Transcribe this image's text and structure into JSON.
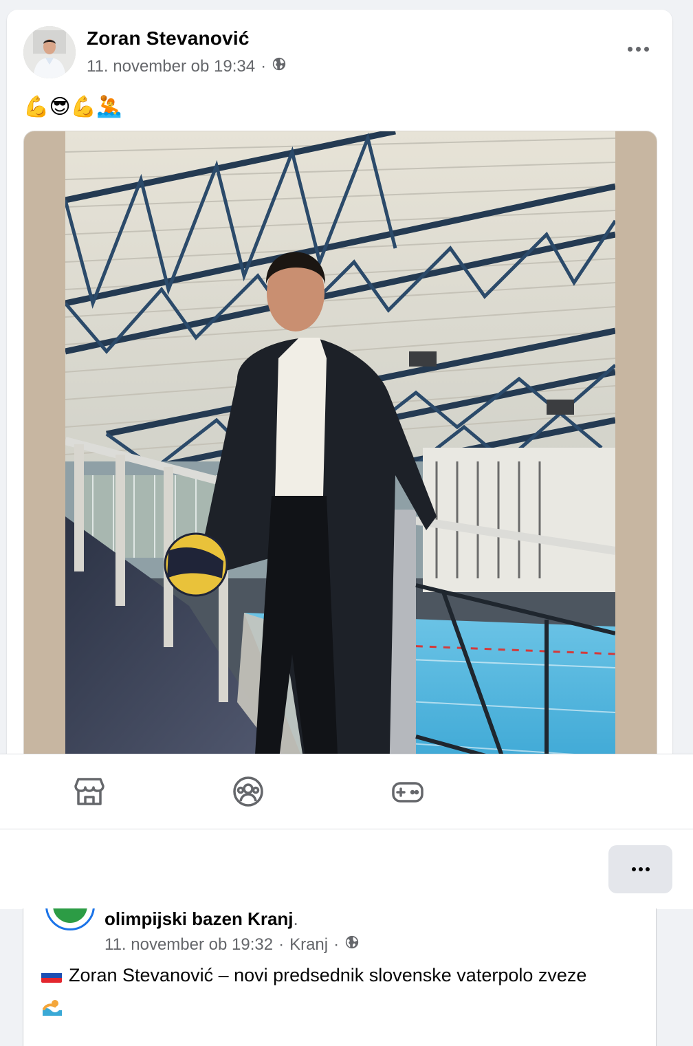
{
  "post": {
    "author": "Zoran Stevanović",
    "timestamp": "11. november ob 19:34",
    "separator": "·",
    "privacy_icon": "globe-icon",
    "more_icon": "more-horizontal-icon",
    "emojis": "💪😎💪🤽"
  },
  "bottom_nav": {
    "items": [
      {
        "icon": "marketplace-icon"
      },
      {
        "icon": "groups-icon"
      },
      {
        "icon": "gaming-icon"
      }
    ]
  },
  "toolbar": {
    "menu_icon": "more-horizontal-icon"
  },
  "shared_post": {
    "author": "olimpijski bazen Kranj",
    "author_suffix": ".",
    "timestamp": "11. november ob 19:32",
    "separator": "·",
    "location": "Kranj",
    "separator2": "·",
    "privacy_icon": "globe-icon",
    "text": "Zoran Stevanović – novi predsednik slovenske vaterpolo zveze",
    "flag_icon": "slovenia-flag-icon",
    "trailing_icon": "swimmer-emoji-icon"
  },
  "colors": {
    "secondary_text": "#65676b",
    "card_bg": "#ffffff",
    "page_bg": "#f0f2f5",
    "photo_side_bg": "#c7b6a1",
    "pool_blue": "#3aa9d6"
  }
}
